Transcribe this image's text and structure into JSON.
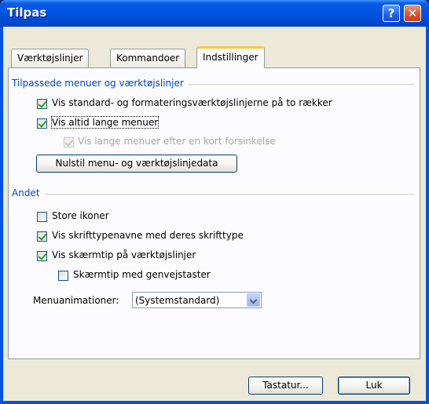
{
  "window": {
    "title": "Tilpas",
    "help_glyph": "?",
    "close_glyph": "✕"
  },
  "tabs": [
    {
      "label": "Værktøjslinjer",
      "active": false
    },
    {
      "label": "Kommandoer",
      "active": false
    },
    {
      "label": "Indstillinger",
      "active": true
    }
  ],
  "group1": {
    "title": "Tilpassede menuer og værktøjslinjer",
    "options": [
      {
        "label": "Vis standard- og formateringsværktøjslinjerne på to rækker",
        "checked": true,
        "enabled": true
      },
      {
        "label": "Vis altid lange menuer",
        "checked": true,
        "enabled": true
      },
      {
        "label": "Vis lange menuer efter en kort forsinkelse",
        "checked": true,
        "enabled": false
      }
    ],
    "reset_button": "Nulstil menu- og værktøjslinjedata"
  },
  "group2": {
    "title": "Andet",
    "options": [
      {
        "label": "Store ikoner",
        "checked": false
      },
      {
        "label": "Vis skrifttypenavne med deres skrifttype",
        "checked": true
      },
      {
        "label": "Vis skærmtip på værktøjslinjer",
        "checked": true
      },
      {
        "label": "Skærmtip med genvejstaster",
        "checked": false
      }
    ],
    "animation_label": "Menuanimationer:",
    "animation_value": "(Systemstandard)"
  },
  "footer": {
    "keyboard_button": "Tastatur...",
    "close_button": "Luk"
  },
  "colors": {
    "title_bar": "#0054e3",
    "dialog_bg": "#ece9d8",
    "group_title": "#0046d5",
    "active_tab_accent": "#ffc83c"
  }
}
